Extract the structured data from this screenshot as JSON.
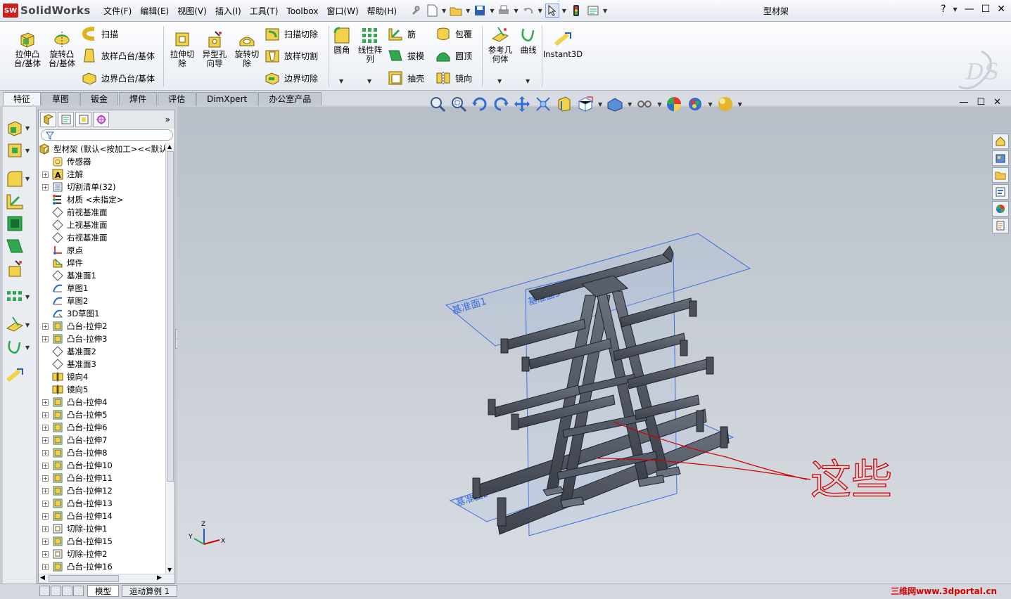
{
  "app": {
    "name": "SolidWorks",
    "logo_text": "SW",
    "document_title": "型材架"
  },
  "menu": [
    "文件(F)",
    "编辑(E)",
    "视图(V)",
    "插入(I)",
    "工具(T)",
    "Toolbox",
    "窗口(W)",
    "帮助(H)"
  ],
  "window_buttons": {
    "help": "?",
    "minimize": "—",
    "restore": "☐",
    "close": "✕"
  },
  "ribbon": {
    "extrude_boss": "拉伸凸\n台/基体",
    "revolve_boss": "旋转凸\n台/基体",
    "sweep": "扫描",
    "loft": "放样凸台/基体",
    "boundary_boss": "边界凸台/基体",
    "extrude_cut": "拉伸切\n除",
    "hole_wizard": "异型孔\n向导",
    "revolve_cut": "旋转切\n除",
    "swept_cut": "扫描切除",
    "lofted_cut": "放样切割",
    "boundary_cut": "边界切除",
    "fillet": "圆角",
    "linear_pattern": "线性阵\n列",
    "rib": "筋",
    "draft": "拔模",
    "shell": "抽壳",
    "wrap": "包覆",
    "dome": "圆顶",
    "mirror": "镜向",
    "ref_geometry": "参考几\n何体",
    "curves": "曲线",
    "instant3d": "Instant3D"
  },
  "command_tabs": [
    "特征",
    "草图",
    "钣金",
    "焊件",
    "评估",
    "DimXpert",
    "办公室产品"
  ],
  "active_tab": "特征",
  "tree": {
    "root": "型材架  (默认<按加工><<默认",
    "items": [
      {
        "label": "传感器",
        "exp": false,
        "icon": "sensor"
      },
      {
        "label": "注解",
        "exp": true,
        "icon": "annotation"
      },
      {
        "label": "切割清单(32)",
        "exp": true,
        "icon": "cutlist"
      },
      {
        "label": "材质 <未指定>",
        "exp": false,
        "icon": "material"
      },
      {
        "label": "前视基准面",
        "exp": false,
        "icon": "plane"
      },
      {
        "label": "上视基准面",
        "exp": false,
        "icon": "plane"
      },
      {
        "label": "右视基准面",
        "exp": false,
        "icon": "plane"
      },
      {
        "label": "原点",
        "exp": false,
        "icon": "origin"
      },
      {
        "label": "焊件",
        "exp": false,
        "icon": "weldment"
      },
      {
        "label": "基准面1",
        "exp": false,
        "icon": "plane"
      },
      {
        "label": "草图1",
        "exp": false,
        "icon": "sketch"
      },
      {
        "label": "草图2",
        "exp": false,
        "icon": "sketch"
      },
      {
        "label": "3D草图1",
        "exp": false,
        "icon": "sketch3d"
      },
      {
        "label": "凸台-拉伸2",
        "exp": true,
        "icon": "extrude"
      },
      {
        "label": "凸台-拉伸3",
        "exp": true,
        "icon": "extrude"
      },
      {
        "label": "基准面2",
        "exp": false,
        "icon": "plane"
      },
      {
        "label": "基准面3",
        "exp": false,
        "icon": "plane"
      },
      {
        "label": "镜向4",
        "exp": false,
        "icon": "mirror"
      },
      {
        "label": "镜向5",
        "exp": false,
        "icon": "mirror"
      },
      {
        "label": "凸台-拉伸4",
        "exp": true,
        "icon": "extrude"
      },
      {
        "label": "凸台-拉伸5",
        "exp": true,
        "icon": "extrude"
      },
      {
        "label": "凸台-拉伸6",
        "exp": true,
        "icon": "extrude"
      },
      {
        "label": "凸台-拉伸7",
        "exp": true,
        "icon": "extrude"
      },
      {
        "label": "凸台-拉伸8",
        "exp": true,
        "icon": "extrude"
      },
      {
        "label": "凸台-拉伸10",
        "exp": true,
        "icon": "extrude"
      },
      {
        "label": "凸台-拉伸11",
        "exp": true,
        "icon": "extrude"
      },
      {
        "label": "凸台-拉伸12",
        "exp": true,
        "icon": "extrude"
      },
      {
        "label": "凸台-拉伸13",
        "exp": true,
        "icon": "extrude"
      },
      {
        "label": "凸台-拉伸14",
        "exp": true,
        "icon": "extrude"
      },
      {
        "label": "切除-拉伸1",
        "exp": true,
        "icon": "cut"
      },
      {
        "label": "凸台-拉伸15",
        "exp": true,
        "icon": "extrude"
      },
      {
        "label": "切除-拉伸2",
        "exp": true,
        "icon": "cut"
      },
      {
        "label": "凸台-拉伸16",
        "exp": true,
        "icon": "extrude"
      }
    ]
  },
  "viewport": {
    "plane_labels": [
      "基准面1",
      "基准面3",
      "基准面2"
    ],
    "annotation": "这些",
    "triad": {
      "x": "X",
      "y": "Y",
      "z": "Z"
    }
  },
  "bottom_tabs": [
    "模型",
    "运动算例 1"
  ],
  "watermark": "三维网www.3dportal.cn",
  "colors": {
    "accent": "#1f5fbf",
    "model": "#4a4f5a",
    "plane": "#3a6fe0",
    "annotation": "#d00000"
  }
}
